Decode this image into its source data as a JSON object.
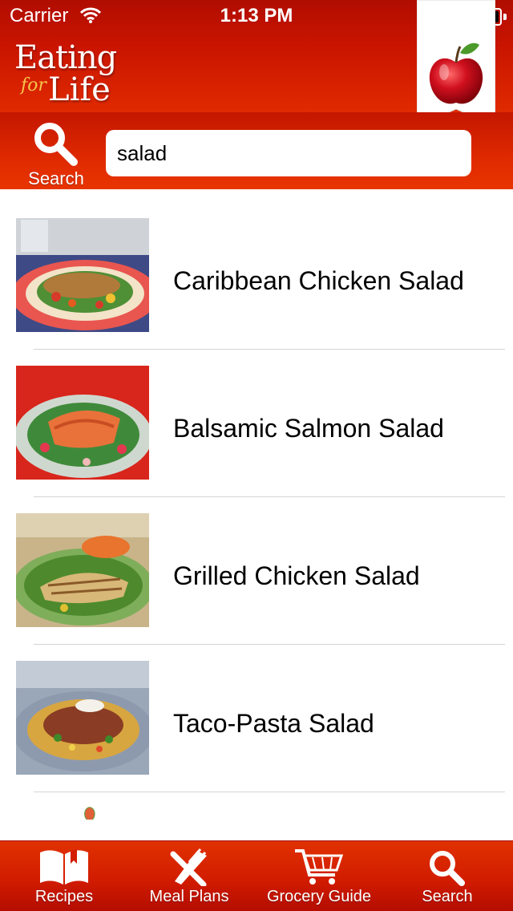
{
  "status_bar": {
    "carrier": "Carrier",
    "time": "1:13 PM"
  },
  "app": {
    "logo_line1": "Eating",
    "logo_for": "for",
    "logo_line2": "Life"
  },
  "search": {
    "button_label": "Search",
    "query": "salad"
  },
  "results": [
    {
      "title": "Caribbean Chicken Salad",
      "image": "caribbean-chicken-salad-photo"
    },
    {
      "title": "Balsamic Salmon Salad",
      "image": "balsamic-salmon-salad-photo"
    },
    {
      "title": "Grilled Chicken Salad",
      "image": "grilled-chicken-salad-photo"
    },
    {
      "title": "Taco-Pasta Salad",
      "image": "taco-pasta-salad-photo"
    }
  ],
  "tabs": [
    {
      "label": "Recipes",
      "icon": "book-icon"
    },
    {
      "label": "Meal Plans",
      "icon": "fork-knife-icon"
    },
    {
      "label": "Grocery Guide",
      "icon": "cart-icon"
    },
    {
      "label": "Search",
      "icon": "search-icon"
    }
  ],
  "colors": {
    "brand_red": "#d21c00",
    "ribbon": "#ffffff",
    "apple": "#c8102e"
  }
}
